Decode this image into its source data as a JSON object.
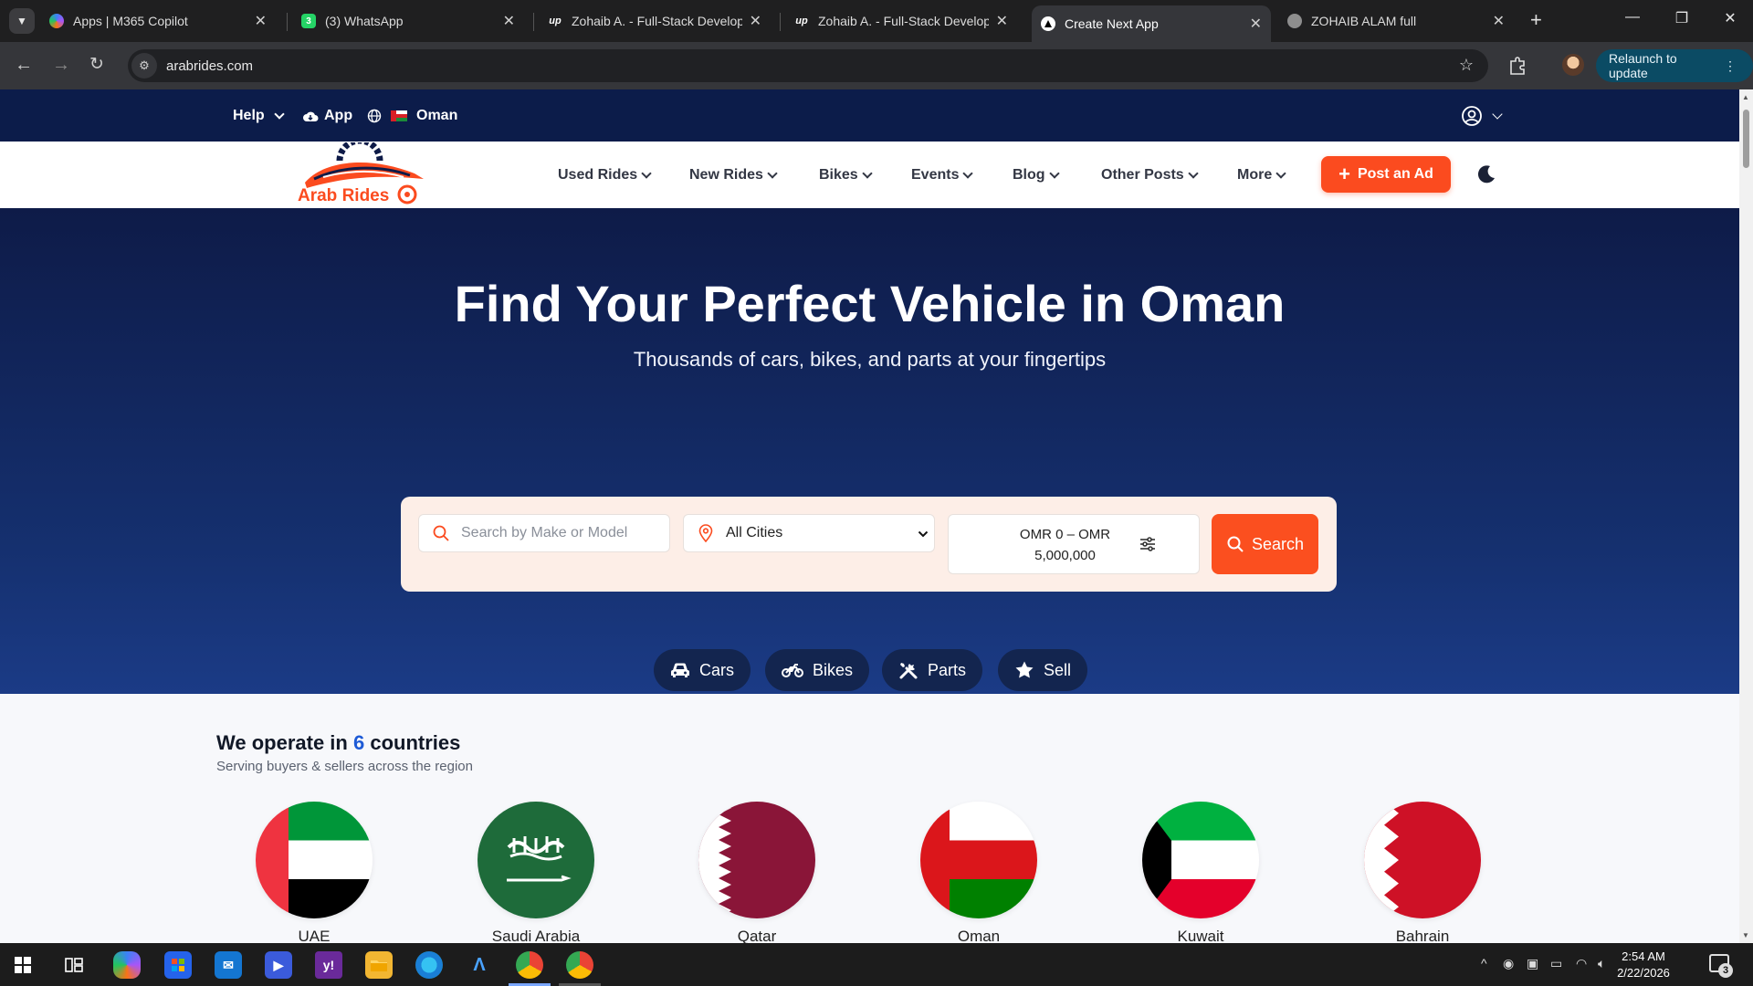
{
  "browser": {
    "tabs": [
      {
        "title": "Apps | M365 Copilot",
        "active": false,
        "icon": "copilot-icon"
      },
      {
        "title": "(3) WhatsApp",
        "active": false,
        "icon": "whatsapp-icon",
        "badge": "3"
      },
      {
        "title": "Zohaib A. - Full-Stack Develope",
        "active": false,
        "icon": "upwork-icon",
        "favicon_text": "up"
      },
      {
        "title": "Zohaib A. - Full-Stack Develope",
        "active": false,
        "icon": "upwork-icon",
        "favicon_text": "up"
      },
      {
        "title": "Create Next App",
        "active": true,
        "icon": "nextjs-icon"
      },
      {
        "title": "ZOHAIB ALAM full",
        "active": false,
        "icon": "globe-icon"
      }
    ],
    "url": "arabrides.com",
    "relaunch_label": "Relaunch to update"
  },
  "site": {
    "topbar": {
      "help": "Help",
      "app": "App",
      "country": "Oman"
    },
    "nav": {
      "items": [
        "Used Rides",
        "New Rides",
        "Bikes",
        "Events",
        "Blog",
        "Other Posts",
        "More"
      ],
      "post_ad": "Post an Ad",
      "logo_text": "Arab Rides"
    },
    "hero": {
      "title": "Find Your Perfect Vehicle in Oman",
      "subtitle": "Thousands of cars, bikes, and parts at your fingertips",
      "search_placeholder": "Search by Make or Model",
      "city_selected": "All Cities",
      "price_range": "OMR 0 – OMR 5,000,000",
      "search_button": "Search",
      "quick_links": [
        "Cars",
        "Bikes",
        "Parts",
        "Sell"
      ]
    },
    "countries": {
      "heading_prefix": "We operate in ",
      "count": "6",
      "heading_suffix": " countries",
      "subtitle": "Serving buyers & sellers across the region",
      "list": [
        "UAE",
        "Saudi Arabia",
        "Qatar",
        "Oman",
        "Kuwait",
        "Bahrain"
      ]
    },
    "colors": {
      "accent": "#fb4b1f",
      "hero_navy": "#0e1b48",
      "link_blue": "#1d5ad6"
    }
  },
  "taskbar": {
    "time": "2:54 AM",
    "date": "2/22/2026",
    "notifications": "3"
  }
}
